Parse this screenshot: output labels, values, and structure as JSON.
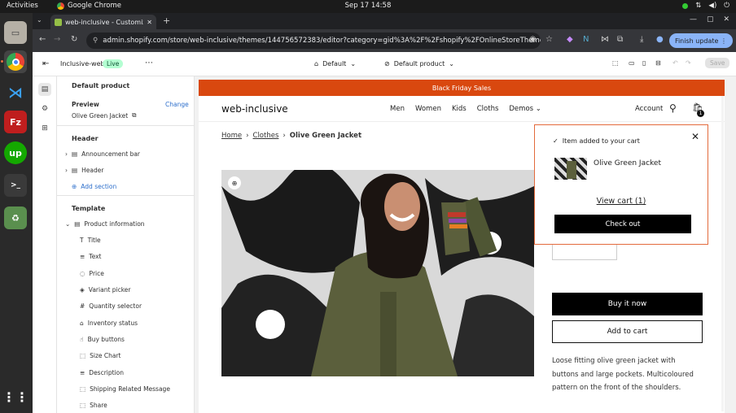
{
  "os": {
    "activities": "Activities",
    "app_name": "Google Chrome",
    "clock": "Sep 17  14:58"
  },
  "browser": {
    "tab_title": "web-inclusive - Customiz",
    "url": "admin.shopify.com/store/web-inclusive/themes/144756572383/editor?category=gid%3A%2F%2Fshopify%2FOnlineStoreThemeSettingsCateg...",
    "finish_update": "Finish update"
  },
  "editor": {
    "store_name": "Inclusive-web",
    "live_badge": "Live",
    "theme_select": "Default",
    "template_select": "Default product",
    "save": "Save"
  },
  "panel": {
    "title": "Default product",
    "preview_label": "Preview",
    "change": "Change",
    "preview_product": "Olive Green Jacket",
    "header_group": "Header",
    "header_items": [
      "Announcement bar",
      "Header"
    ],
    "add_section": "Add section",
    "template_group": "Template",
    "product_information": "Product information",
    "blocks": [
      "Title",
      "Text",
      "Price",
      "Variant picker",
      "Quantity selector",
      "Inventory status",
      "Buy buttons",
      "Size Chart",
      "Description",
      "Shipping Related Message",
      "Share"
    ]
  },
  "store": {
    "banner": "Black Friday Sales",
    "logo": "web-inclusive",
    "nav": [
      "Men",
      "Women",
      "Kids",
      "Cloths",
      "Demos"
    ],
    "account": "Account",
    "cart_count": "1",
    "breadcrumb": [
      "Home",
      "Clothes",
      "Olive Green Jacket"
    ],
    "buy_now": "Buy it now",
    "add_to_cart": "Add to cart",
    "description": "Loose fitting olive green jacket with buttons and large pockets. Multicoloured pattern on the front of the shoulders."
  },
  "cart_popup": {
    "added_text": "Item added to your cart",
    "product_name": "Olive Green Jacket",
    "view_cart": "View cart (1)",
    "check_out": "Check out"
  },
  "colors": {
    "banner": "#d9480f",
    "popup_border": "#e36a3c",
    "live_badge": "#b4fed2",
    "finish_button": "#8ab4f8"
  }
}
